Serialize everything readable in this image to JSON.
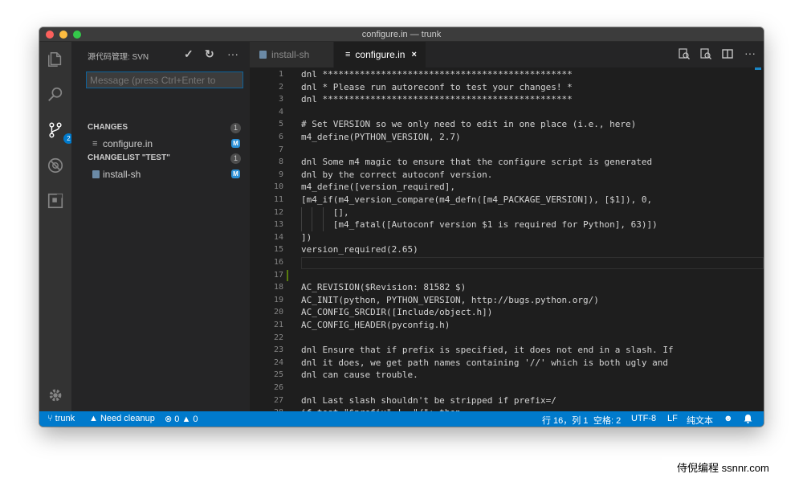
{
  "window": {
    "title": "configure.in — trunk"
  },
  "colors": {
    "accent": "#007acc",
    "added_gutter": "#587c0c",
    "modified_badge": "#2a8fd6"
  },
  "activity_bar": {
    "icons": [
      "explorer-icon",
      "search-icon",
      "source-control-icon",
      "debug-icon",
      "extensions-icon",
      "gear-icon"
    ],
    "scm_badge": "2"
  },
  "sidebar": {
    "title": "源代码管理: SVN",
    "actions": {
      "commit": "✓",
      "refresh": "↻",
      "more": "···"
    },
    "message_placeholder": "Message (press Ctrl+Enter to",
    "groups": [
      {
        "label": "CHANGES",
        "count": "1",
        "files": [
          {
            "name": "configure.in",
            "status": "M"
          }
        ]
      },
      {
        "label": "CHANGELIST \"TEST\"",
        "count": "1",
        "files": [
          {
            "name": "install-sh",
            "status": "M"
          }
        ]
      }
    ]
  },
  "tabs": [
    {
      "label": "install-sh",
      "active": false
    },
    {
      "label": "configure.in",
      "active": true,
      "close": "×"
    }
  ],
  "editor_actions": [
    "open-changes-icon",
    "open-file-icon",
    "split-editor-icon",
    "more-icon"
  ],
  "editor": {
    "current_line": 16,
    "modified_line": 17,
    "lines": [
      {
        "n": "1",
        "t": "dnl ***********************************************"
      },
      {
        "n": "2",
        "t": "dnl * Please run autoreconf to test your changes! *"
      },
      {
        "n": "3",
        "t": "dnl ***********************************************"
      },
      {
        "n": "4",
        "t": ""
      },
      {
        "n": "5",
        "t": "# Set VERSION so we only need to edit in one place (i.e., here)"
      },
      {
        "n": "6",
        "t": "m4_define(PYTHON_VERSION, 2.7)"
      },
      {
        "n": "7",
        "t": ""
      },
      {
        "n": "8",
        "t": "dnl Some m4 magic to ensure that the configure script is generated"
      },
      {
        "n": "9",
        "t": "dnl by the correct autoconf version."
      },
      {
        "n": "10",
        "t": "m4_define([version_required],"
      },
      {
        "n": "11",
        "t": "[m4_if(m4_version_compare(m4_defn([m4_PACKAGE_VERSION]), [$1]), 0,"
      },
      {
        "n": "12",
        "t": "      [],",
        "guides": 3
      },
      {
        "n": "13",
        "t": "      [m4_fatal([Autoconf version $1 is required for Python], 63)])",
        "guides": 3
      },
      {
        "n": "14",
        "t": "])"
      },
      {
        "n": "15",
        "t": "version_required(2.65)"
      },
      {
        "n": "16",
        "t": ""
      },
      {
        "n": "17",
        "t": ""
      },
      {
        "n": "18",
        "t": "AC_REVISION($Revision: 81582 $)"
      },
      {
        "n": "19",
        "t": "AC_INIT(python, PYTHON_VERSION, http://bugs.python.org/)"
      },
      {
        "n": "20",
        "t": "AC_CONFIG_SRCDIR([Include/object.h])"
      },
      {
        "n": "21",
        "t": "AC_CONFIG_HEADER(pyconfig.h)"
      },
      {
        "n": "22",
        "t": ""
      },
      {
        "n": "23",
        "t": "dnl Ensure that if prefix is specified, it does not end in a slash. If"
      },
      {
        "n": "24",
        "t": "dnl it does, we get path names containing '//' which is both ugly and"
      },
      {
        "n": "25",
        "t": "dnl can cause trouble."
      },
      {
        "n": "26",
        "t": ""
      },
      {
        "n": "27",
        "t": "dnl Last slash shouldn't be stripped if prefix=/"
      },
      {
        "n": "28",
        "t": "if test \"$prefix\" != \"/\"; then"
      }
    ]
  },
  "statusbar": {
    "branch": "trunk",
    "warning": "Need cleanup",
    "errors": "0",
    "warnings": "0",
    "position": "行 16，列 1",
    "spaces": "空格: 2",
    "encoding": "UTF-8",
    "eol": "LF",
    "language": "纯文本"
  },
  "watermark": "侍倪编程 ssnnr.com"
}
